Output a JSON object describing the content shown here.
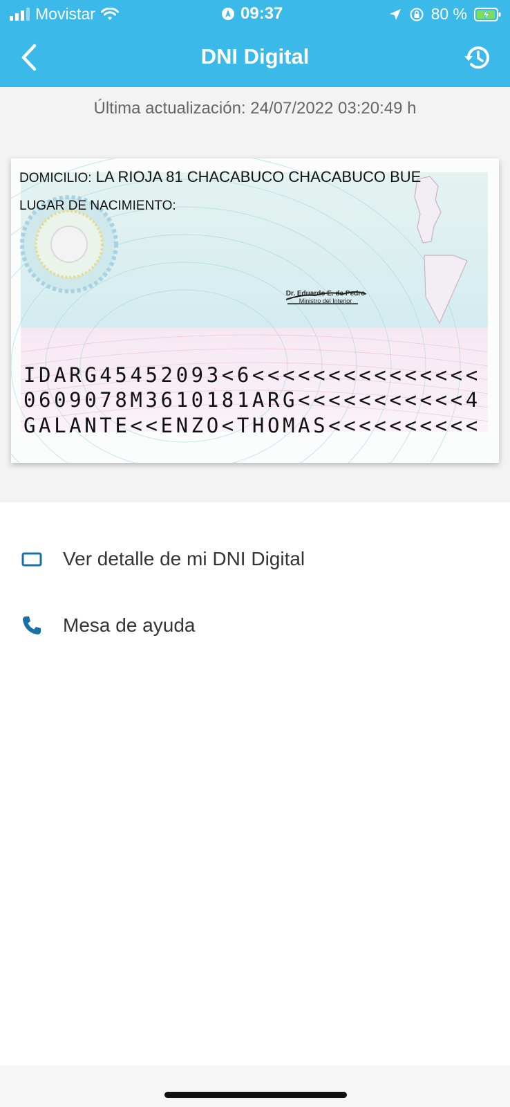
{
  "status_bar": {
    "carrier": "Movistar",
    "time": "09:37",
    "battery": "80 %"
  },
  "header": {
    "title": "DNI Digital"
  },
  "last_update": "Última actualización: 24/07/2022 03:20:49 h",
  "card": {
    "domicilio_label": "DOMICILIO:",
    "domicilio_value": "LA RIOJA 81   CHACABUCO CHACABUCO BUE",
    "nacimiento_label": "LUGAR DE NACIMIENTO:",
    "signature_script": "E de Pedro",
    "signature_name": "Dr. Eduardo E. de Pedro",
    "signature_role": "Ministro del Interior",
    "mrz_line_1": "IDARG45452093<6<<<<<<<<<<<<<<<",
    "mrz_line_2": "0609078M3610181ARG<<<<<<<<<<<4",
    "mrz_line_3": "GALANTE<<ENZO<THOMAS<<<<<<<<<<"
  },
  "menu": [
    {
      "label": "Ver detalle de mi DNI Digital",
      "icon": "card-outline-icon"
    },
    {
      "label": "Mesa de ayuda",
      "icon": "phone-icon"
    }
  ],
  "colors": {
    "header_bg": "#3bbaea",
    "icon_blue": "#1a6fa8"
  }
}
